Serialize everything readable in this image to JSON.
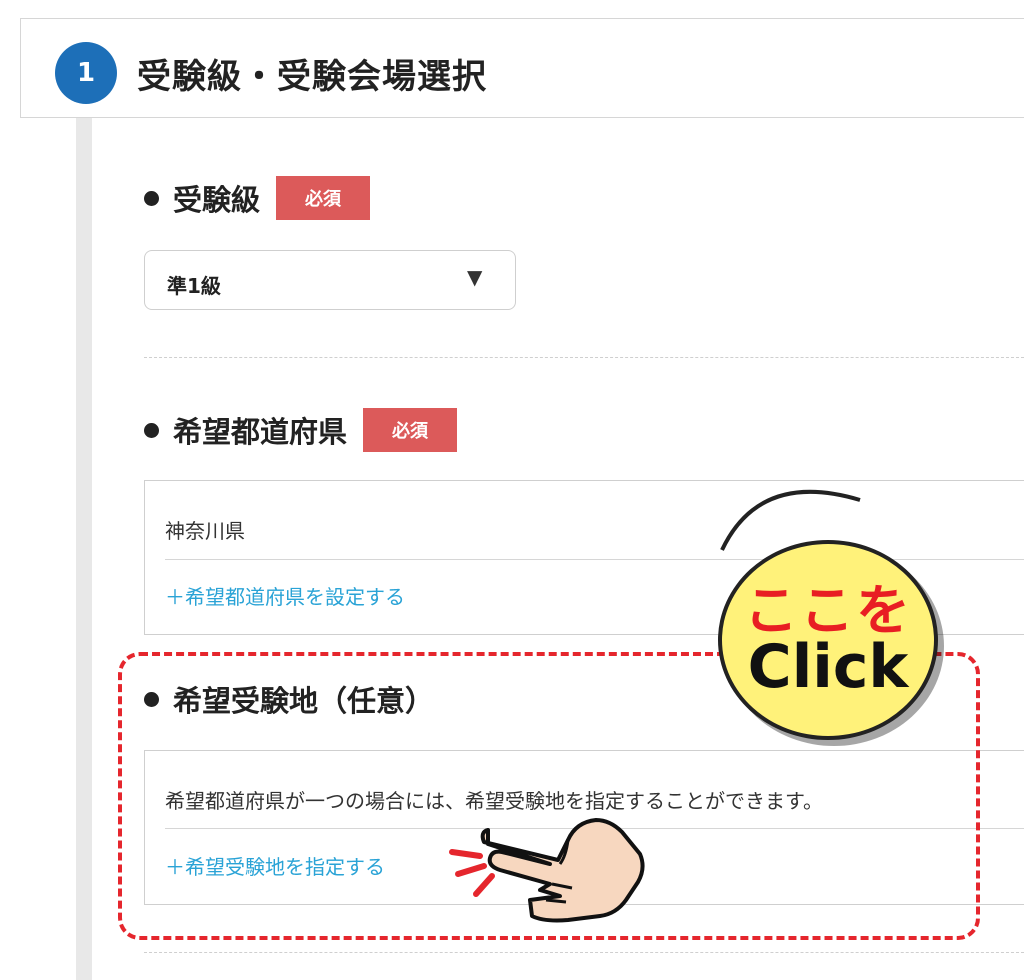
{
  "header": {
    "step_number": "1",
    "title": "受験級・受験会場選択"
  },
  "grade_section": {
    "label": "受験級",
    "required_badge": "必須",
    "select": {
      "selected_value": "準1級",
      "arrow": "▼"
    }
  },
  "prefecture_section": {
    "label": "希望都道府県",
    "required_badge": "必須",
    "current_value": "神奈川県",
    "set_link": "＋希望都道府県を設定する"
  },
  "venue_section": {
    "label": "希望受験地（任意）",
    "description": "希望都道府県が一つの場合には、希望受験地を指定することができます。",
    "specify_link": "＋希望受験地を指定する"
  },
  "callout": {
    "line1": "ここを",
    "line2": "Click"
  },
  "colors": {
    "step_blue": "#1d6fb8",
    "required_red": "#dc5a5a",
    "link_blue": "#2aa3d6",
    "highlight_red": "#e5262d",
    "bubble_yellow": "#fff27a"
  },
  "icons": {
    "hand": "pointing-hand-icon",
    "select_arrow": "triangle-down-icon"
  }
}
